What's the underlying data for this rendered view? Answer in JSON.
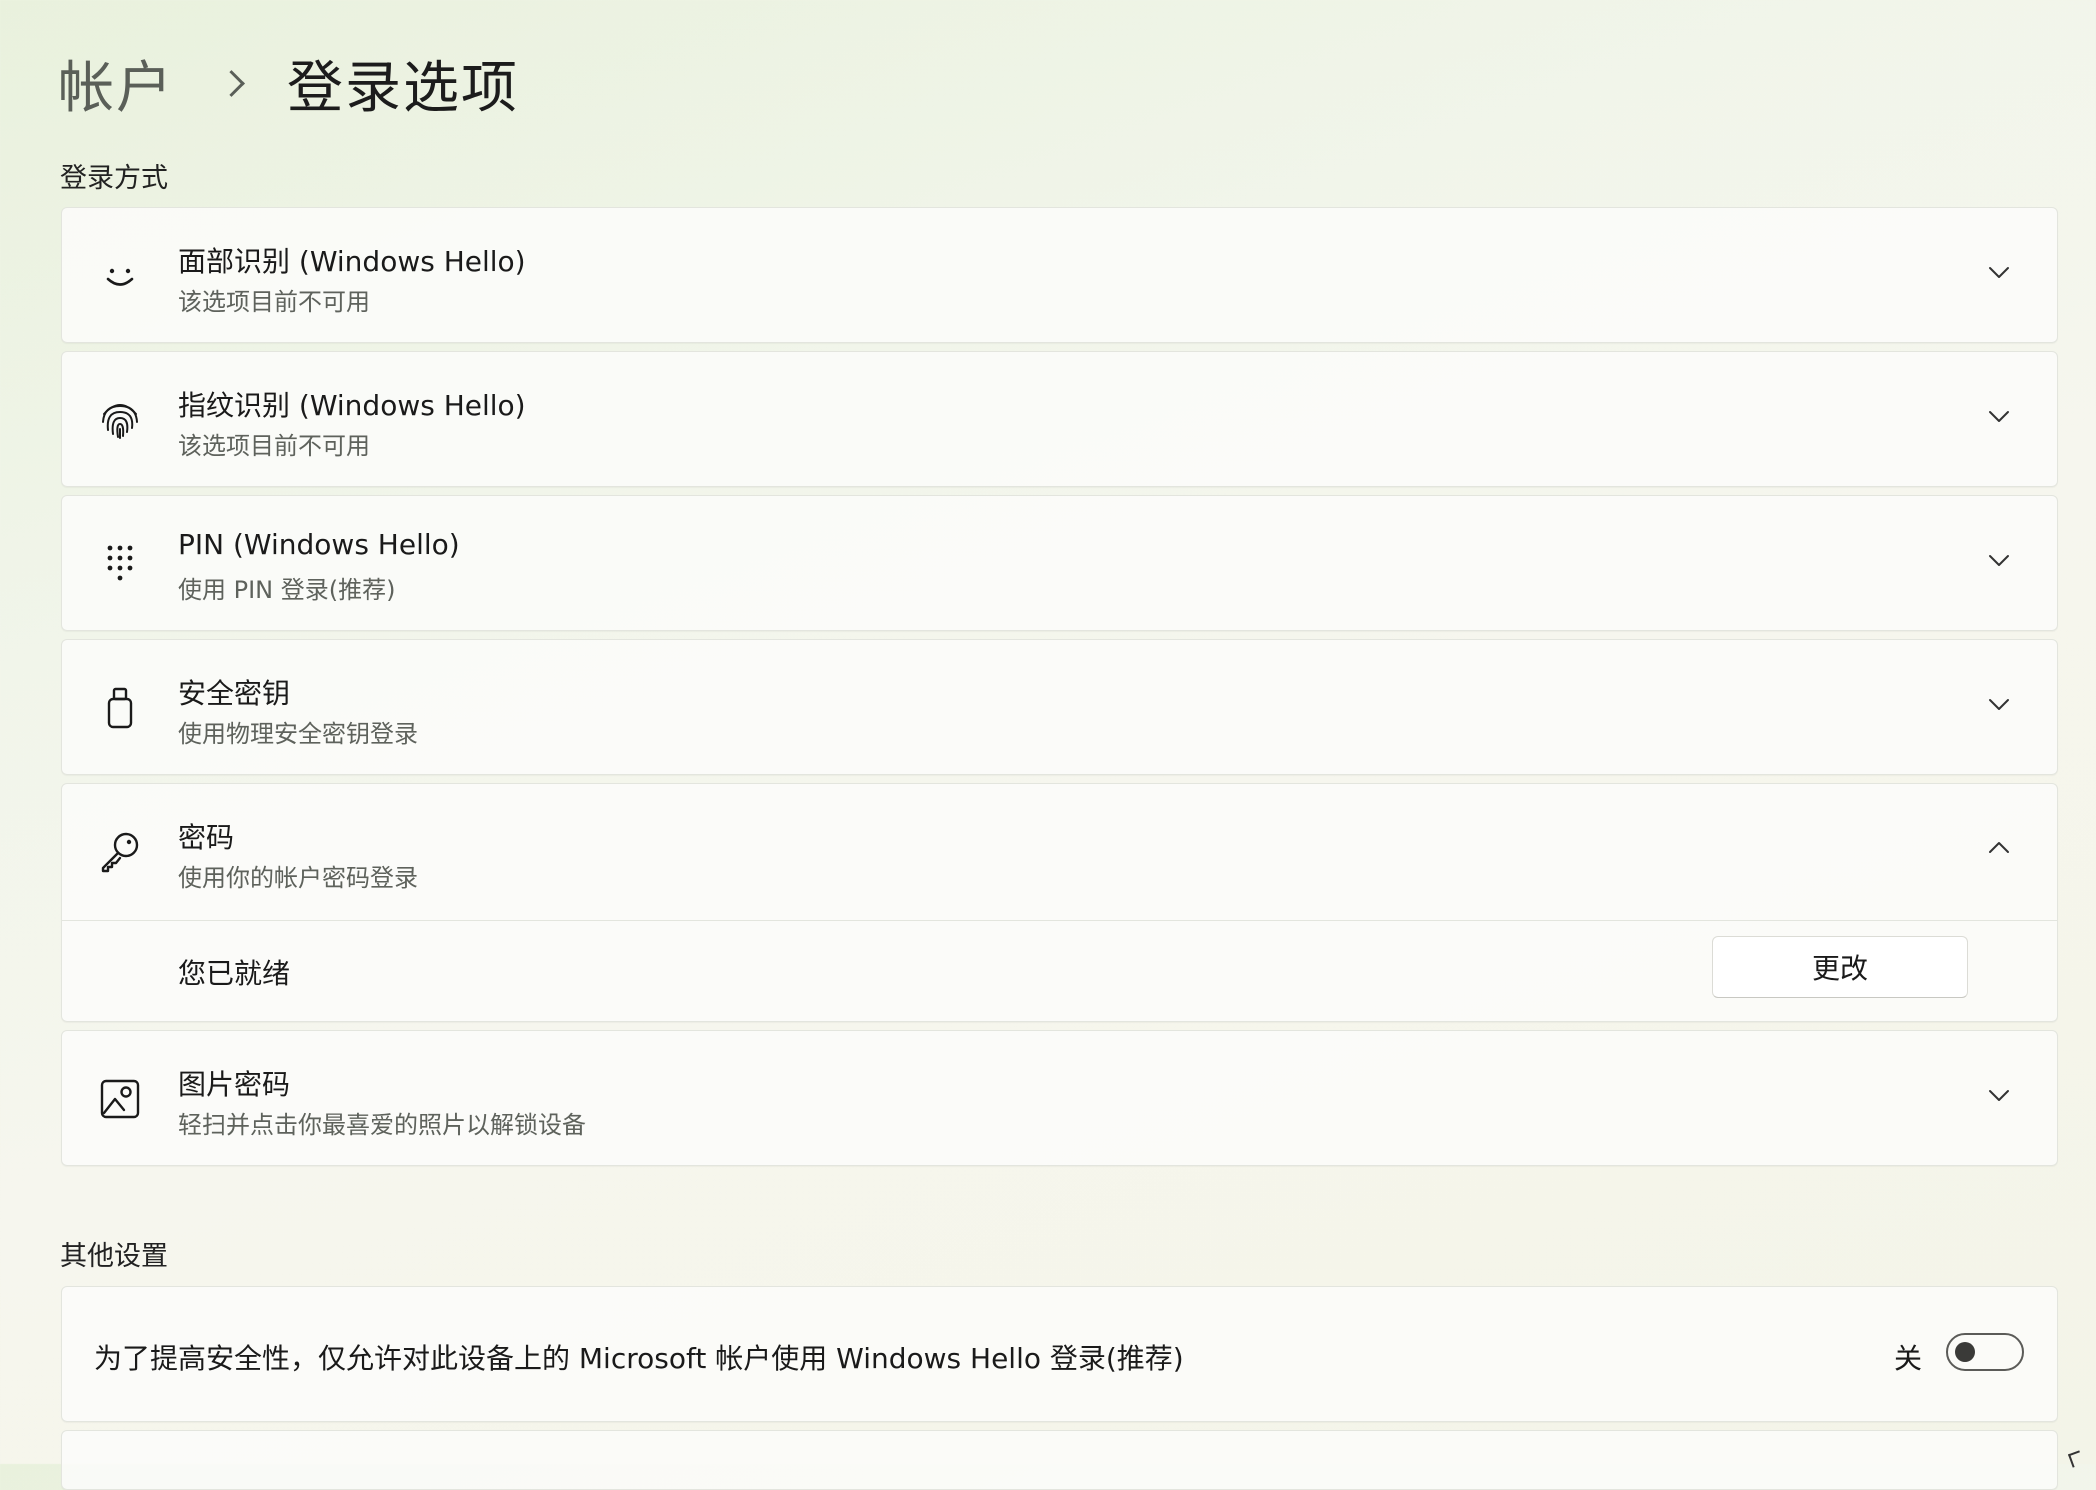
{
  "breadcrumb": {
    "parent": "帐户",
    "current": "登录选项"
  },
  "sections": {
    "sign_in_methods": "登录方式",
    "other_settings": "其他设置"
  },
  "methods": [
    {
      "id": "face",
      "icon": "smiley-face-icon",
      "title": "面部识别 (Windows Hello)",
      "subtitle": "该选项目前不可用",
      "expanded": false
    },
    {
      "id": "fingerprint",
      "icon": "fingerprint-icon",
      "title": "指纹识别 (Windows Hello)",
      "subtitle": "该选项目前不可用",
      "expanded": false
    },
    {
      "id": "pin",
      "icon": "keypad-dots-icon",
      "title": "PIN (Windows Hello)",
      "subtitle": "使用 PIN 登录(推荐)",
      "expanded": false
    },
    {
      "id": "security_key",
      "icon": "usb-key-icon",
      "title": "安全密钥",
      "subtitle": "使用物理安全密钥登录",
      "expanded": false
    },
    {
      "id": "password",
      "icon": "key-icon",
      "title": "密码",
      "subtitle": "使用你的帐户密码登录",
      "expanded": true
    },
    {
      "id": "picture_password",
      "icon": "picture-icon",
      "title": "图片密码",
      "subtitle": "轻扫并点击你最喜爱的照片以解锁设备",
      "expanded": false
    }
  ],
  "password_panel": {
    "status": "您已就绪",
    "change_label": "更改"
  },
  "other": {
    "hello_only_text": "为了提高安全性，仅允许对此设备上的 Microsoft 帐户使用 Windows Hello 登录(推荐)",
    "toggle_state_label": "关",
    "toggle_on": false
  }
}
